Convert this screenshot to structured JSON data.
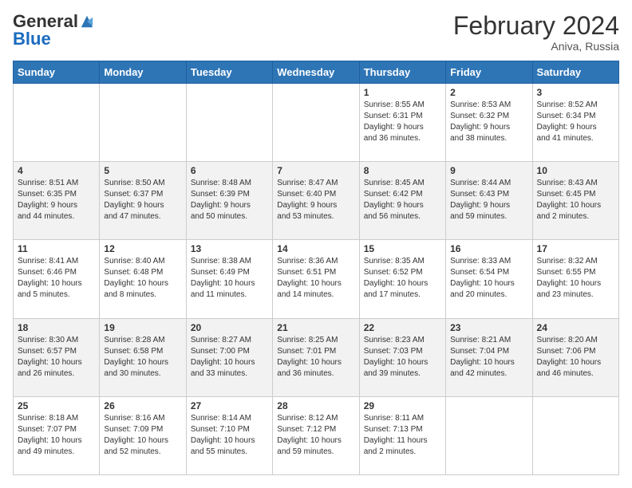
{
  "header": {
    "logo_general": "General",
    "logo_blue": "Blue",
    "month_title": "February 2024",
    "location": "Aniva, Russia"
  },
  "weekdays": [
    "Sunday",
    "Monday",
    "Tuesday",
    "Wednesday",
    "Thursday",
    "Friday",
    "Saturday"
  ],
  "rows": [
    [
      {
        "day": "",
        "info": ""
      },
      {
        "day": "",
        "info": ""
      },
      {
        "day": "",
        "info": ""
      },
      {
        "day": "",
        "info": ""
      },
      {
        "day": "1",
        "info": "Sunrise: 8:55 AM\nSunset: 6:31 PM\nDaylight: 9 hours\nand 36 minutes."
      },
      {
        "day": "2",
        "info": "Sunrise: 8:53 AM\nSunset: 6:32 PM\nDaylight: 9 hours\nand 38 minutes."
      },
      {
        "day": "3",
        "info": "Sunrise: 8:52 AM\nSunset: 6:34 PM\nDaylight: 9 hours\nand 41 minutes."
      }
    ],
    [
      {
        "day": "4",
        "info": "Sunrise: 8:51 AM\nSunset: 6:35 PM\nDaylight: 9 hours\nand 44 minutes."
      },
      {
        "day": "5",
        "info": "Sunrise: 8:50 AM\nSunset: 6:37 PM\nDaylight: 9 hours\nand 47 minutes."
      },
      {
        "day": "6",
        "info": "Sunrise: 8:48 AM\nSunset: 6:39 PM\nDaylight: 9 hours\nand 50 minutes."
      },
      {
        "day": "7",
        "info": "Sunrise: 8:47 AM\nSunset: 6:40 PM\nDaylight: 9 hours\nand 53 minutes."
      },
      {
        "day": "8",
        "info": "Sunrise: 8:45 AM\nSunset: 6:42 PM\nDaylight: 9 hours\nand 56 minutes."
      },
      {
        "day": "9",
        "info": "Sunrise: 8:44 AM\nSunset: 6:43 PM\nDaylight: 9 hours\nand 59 minutes."
      },
      {
        "day": "10",
        "info": "Sunrise: 8:43 AM\nSunset: 6:45 PM\nDaylight: 10 hours\nand 2 minutes."
      }
    ],
    [
      {
        "day": "11",
        "info": "Sunrise: 8:41 AM\nSunset: 6:46 PM\nDaylight: 10 hours\nand 5 minutes."
      },
      {
        "day": "12",
        "info": "Sunrise: 8:40 AM\nSunset: 6:48 PM\nDaylight: 10 hours\nand 8 minutes."
      },
      {
        "day": "13",
        "info": "Sunrise: 8:38 AM\nSunset: 6:49 PM\nDaylight: 10 hours\nand 11 minutes."
      },
      {
        "day": "14",
        "info": "Sunrise: 8:36 AM\nSunset: 6:51 PM\nDaylight: 10 hours\nand 14 minutes."
      },
      {
        "day": "15",
        "info": "Sunrise: 8:35 AM\nSunset: 6:52 PM\nDaylight: 10 hours\nand 17 minutes."
      },
      {
        "day": "16",
        "info": "Sunrise: 8:33 AM\nSunset: 6:54 PM\nDaylight: 10 hours\nand 20 minutes."
      },
      {
        "day": "17",
        "info": "Sunrise: 8:32 AM\nSunset: 6:55 PM\nDaylight: 10 hours\nand 23 minutes."
      }
    ],
    [
      {
        "day": "18",
        "info": "Sunrise: 8:30 AM\nSunset: 6:57 PM\nDaylight: 10 hours\nand 26 minutes."
      },
      {
        "day": "19",
        "info": "Sunrise: 8:28 AM\nSunset: 6:58 PM\nDaylight: 10 hours\nand 30 minutes."
      },
      {
        "day": "20",
        "info": "Sunrise: 8:27 AM\nSunset: 7:00 PM\nDaylight: 10 hours\nand 33 minutes."
      },
      {
        "day": "21",
        "info": "Sunrise: 8:25 AM\nSunset: 7:01 PM\nDaylight: 10 hours\nand 36 minutes."
      },
      {
        "day": "22",
        "info": "Sunrise: 8:23 AM\nSunset: 7:03 PM\nDaylight: 10 hours\nand 39 minutes."
      },
      {
        "day": "23",
        "info": "Sunrise: 8:21 AM\nSunset: 7:04 PM\nDaylight: 10 hours\nand 42 minutes."
      },
      {
        "day": "24",
        "info": "Sunrise: 8:20 AM\nSunset: 7:06 PM\nDaylight: 10 hours\nand 46 minutes."
      }
    ],
    [
      {
        "day": "25",
        "info": "Sunrise: 8:18 AM\nSunset: 7:07 PM\nDaylight: 10 hours\nand 49 minutes."
      },
      {
        "day": "26",
        "info": "Sunrise: 8:16 AM\nSunset: 7:09 PM\nDaylight: 10 hours\nand 52 minutes."
      },
      {
        "day": "27",
        "info": "Sunrise: 8:14 AM\nSunset: 7:10 PM\nDaylight: 10 hours\nand 55 minutes."
      },
      {
        "day": "28",
        "info": "Sunrise: 8:12 AM\nSunset: 7:12 PM\nDaylight: 10 hours\nand 59 minutes."
      },
      {
        "day": "29",
        "info": "Sunrise: 8:11 AM\nSunset: 7:13 PM\nDaylight: 11 hours\nand 2 minutes."
      },
      {
        "day": "",
        "info": ""
      },
      {
        "day": "",
        "info": ""
      }
    ]
  ]
}
